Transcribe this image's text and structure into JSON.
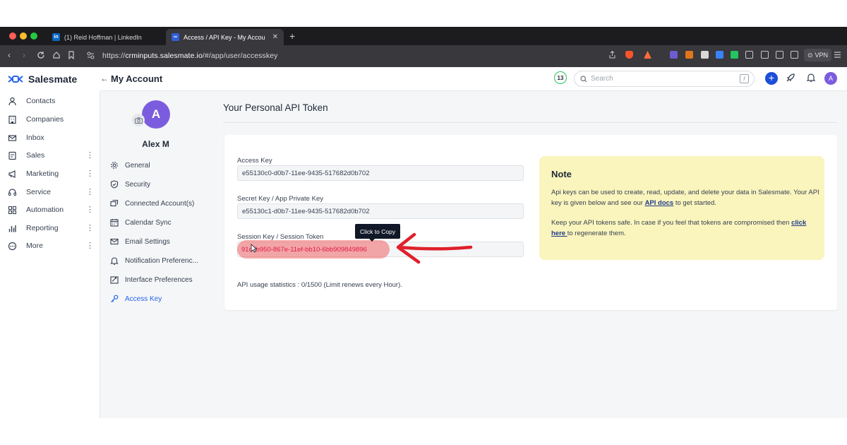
{
  "browser": {
    "tabs": [
      {
        "title": "(1) Reid Hoffman | LinkedIn",
        "favicon": "in",
        "favicon_color": "#0a66c2",
        "active": false
      },
      {
        "title": "Access / API Key - My Accou",
        "favicon": "∞",
        "favicon_color": "#2f5fd9",
        "active": true,
        "close": "✕"
      }
    ],
    "new_tab": "+",
    "url_prefix": "https://",
    "url_host": "crminputs.salesmate.io",
    "url_path": "/#/app/user/accesskey",
    "vpn_label": "VPN"
  },
  "app": {
    "brand": "Salesmate",
    "brand_color": "#2563eb",
    "header": {
      "back": "←",
      "title": "My Account",
      "notification_count": "13",
      "search_placeholder": "Search",
      "search_shortcut": "/",
      "add": "+",
      "avatar_initial": "A"
    },
    "sidebar": {
      "items": [
        {
          "label": "Contacts",
          "icon": "person-icon",
          "has_menu": false
        },
        {
          "label": "Companies",
          "icon": "building-icon",
          "has_menu": false
        },
        {
          "label": "Inbox",
          "icon": "mail-icon",
          "has_menu": false
        },
        {
          "label": "Sales",
          "icon": "sales-icon",
          "has_menu": true
        },
        {
          "label": "Marketing",
          "icon": "megaphone-icon",
          "has_menu": true
        },
        {
          "label": "Service",
          "icon": "headset-icon",
          "has_menu": true
        },
        {
          "label": "Automation",
          "icon": "automation-icon",
          "has_menu": true
        },
        {
          "label": "Reporting",
          "icon": "chart-icon",
          "has_menu": true
        },
        {
          "label": "More",
          "icon": "more-icon",
          "has_menu": true
        }
      ],
      "kebab": "⋮"
    },
    "account_menu": {
      "avatar_initial": "A",
      "name": "Alex M",
      "items": [
        {
          "label": "General",
          "icon": "gear-icon",
          "active": false
        },
        {
          "label": "Security",
          "icon": "shield-icon",
          "active": false
        },
        {
          "label": "Connected Account(s)",
          "icon": "connected-icon",
          "active": false
        },
        {
          "label": "Calendar Sync",
          "icon": "calendar-icon",
          "active": false
        },
        {
          "label": "Email Settings",
          "icon": "mail-icon",
          "active": false
        },
        {
          "label": "Notification Preferenc...",
          "icon": "bell-icon",
          "active": false
        },
        {
          "label": "Interface Preferences",
          "icon": "interface-icon",
          "active": false
        },
        {
          "label": "Access Key",
          "icon": "key-icon",
          "active": true
        }
      ]
    },
    "main": {
      "section_title": "Your Personal API Token",
      "access_key_label": "Access Key",
      "access_key": "e55130c0-d0b7-11ee-9435-517682d0b702",
      "secret_key_label": "Secret Key / App Private Key",
      "secret_key": "e55130c1-d0b7-11ee-9435-517682d0b702",
      "session_key_label": "Session Key / Session Token",
      "session_key": "91c7b950-867e-11ef-bb10-6bb909849896",
      "tooltip": "Click to Copy",
      "usage": "API usage statistics : 0/1500 (Limit renews every Hour)."
    },
    "note": {
      "title": "Note",
      "p1_before": "Api keys can be used to create, read, update, and delete your data in Salesmate. Your API key is given below and see our ",
      "p1_link": "API docs",
      "p1_after": " to get started.",
      "p2_before": "Keep your API tokens safe. In case if you feel that tokens are compromised then ",
      "p2_link": "click here ",
      "p2_after": "to regenerate them."
    }
  }
}
